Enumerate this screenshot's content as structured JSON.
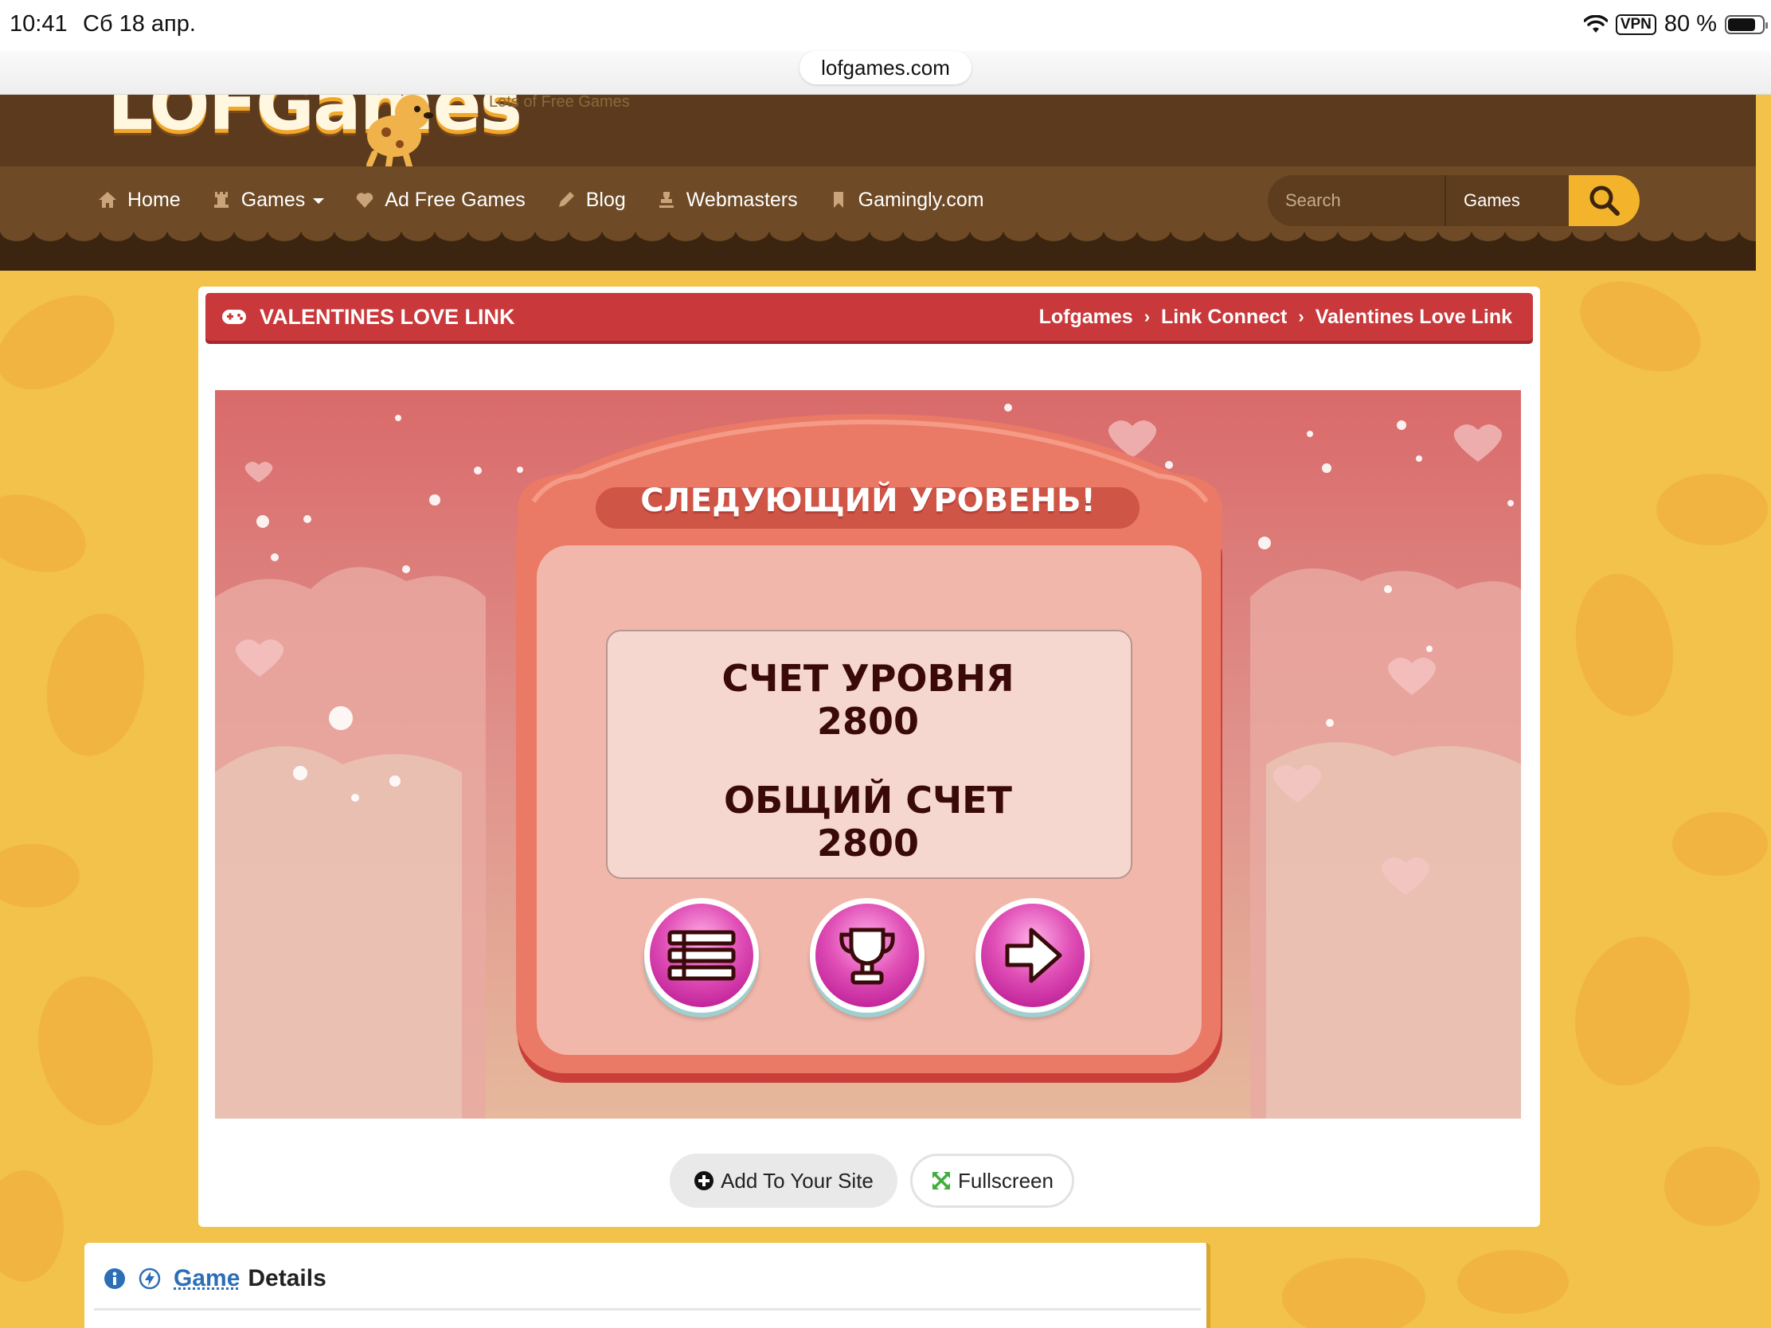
{
  "status_bar": {
    "time": "10:41",
    "date": "Сб 18 апр.",
    "vpn": "VPN",
    "battery": "80 %"
  },
  "browser": {
    "url": "lofgames.com"
  },
  "site": {
    "logo_text": "LOFGames",
    "tagline": "Lots of Free Games",
    "nav": [
      {
        "label": "Home",
        "icon": "home-icon"
      },
      {
        "label": "Games",
        "icon": "rook-icon"
      },
      {
        "label": "Ad Free Games",
        "icon": "heart-icon"
      },
      {
        "label": "Blog",
        "icon": "pencil-icon"
      },
      {
        "label": "Webmasters",
        "icon": "stamp-icon"
      },
      {
        "label": "Gamingly.com",
        "icon": "bookmark-icon"
      }
    ],
    "search": {
      "placeholder": "Search",
      "scope": "Games"
    },
    "colors": {
      "header_brown": "#5c3a1d",
      "nav_brown": "#6e4a26",
      "title_red": "#c9383a",
      "search_yellow": "#f3b32a",
      "page_yellow": "#f2c24a"
    }
  },
  "game_page": {
    "title": "VALENTINES LOVE LINK",
    "breadcrumbs": [
      "Lofgames",
      "Link Connect",
      "Valentines Love Link"
    ],
    "game": {
      "dialog_title": "СЛЕДУЮЩИЙ УРОВЕНЬ!",
      "level_score_label": "СЧЕТ УРОВНЯ",
      "level_score": "2800",
      "total_score_label": "ОБЩИЙ СЧЕТ",
      "total_score": "2800",
      "buttons": [
        "menu-icon",
        "trophy-icon",
        "arrow-right-icon"
      ]
    },
    "actions": {
      "add_to_site": "Add To Your Site",
      "fullscreen": "Fullscreen"
    }
  },
  "details": {
    "game_link": "Game",
    "heading_rest": "Details"
  }
}
